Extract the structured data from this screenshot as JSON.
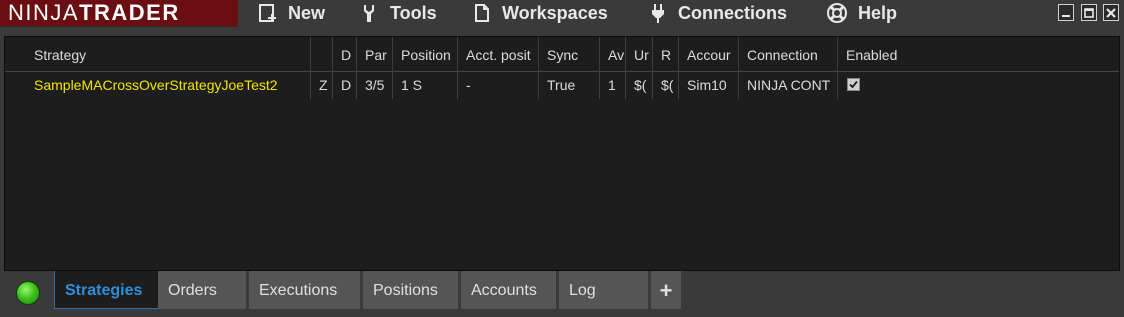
{
  "app": {
    "logo_bold": "NINJA",
    "logo_light": "TRADER"
  },
  "menu": {
    "new": "New",
    "tools": "Tools",
    "workspaces": "Workspaces",
    "connections": "Connections",
    "help": "Help"
  },
  "grid": {
    "columns": [
      "Strategy",
      "",
      "D",
      "Par",
      "Position",
      "Acct. posit",
      "Sync",
      "Av",
      "Ur",
      "R",
      "Accour",
      "Connection",
      "Enabled"
    ],
    "rows": [
      {
        "strategy": "SampleMACrossOverStrategyJoeTest2",
        "col1": "Z",
        "d": "D",
        "par": "3/5",
        "position": "1 S",
        "acct_position": "-",
        "sync": "True",
        "av": "1",
        "ur": "$(",
        "r": "$(",
        "account": "Sim10",
        "connection": "NINJA CONT",
        "enabled": true
      }
    ]
  },
  "tabs": [
    {
      "label": "Strategies",
      "active": true
    },
    {
      "label": "Orders",
      "active": false
    },
    {
      "label": "Executions",
      "active": false
    },
    {
      "label": "Positions",
      "active": false
    },
    {
      "label": "Accounts",
      "active": false
    },
    {
      "label": "Log",
      "active": false
    }
  ],
  "add_tab_label": "+",
  "colors": {
    "brand": "#6a0e12",
    "strategy_name": "#f2e600",
    "active_tab": "#2f8fd8",
    "status": "#3fc320"
  }
}
